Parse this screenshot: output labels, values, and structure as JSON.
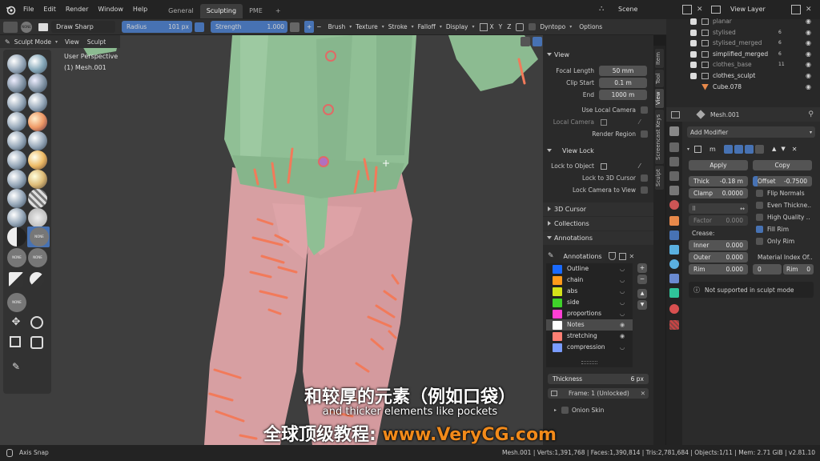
{
  "menu": {
    "items": [
      "File",
      "Edit",
      "Render",
      "Window",
      "Help"
    ]
  },
  "workspaces": [
    {
      "label": "General"
    },
    {
      "label": "Sculpting"
    },
    {
      "label": "PME"
    }
  ],
  "workspace_plus": "+",
  "scene": {
    "label": "Scene"
  },
  "view_layer": {
    "label": "View Layer"
  },
  "tool_header": {
    "brush_name": "Draw Sharp",
    "radius_label": "Radius",
    "radius_value": "101 px",
    "strength_label": "Strength",
    "strength_value": "1.000",
    "plus": "+",
    "minus": "−",
    "brush": "Brush",
    "texture": "Texture",
    "stroke": "Stroke",
    "falloff": "Falloff",
    "display": "Display",
    "x": "X",
    "y": "Y",
    "z": "Z",
    "dyntopo": "Dyntopo",
    "options": "Options"
  },
  "mode_bar": {
    "mode": "Sculpt Mode",
    "view": "View",
    "sculpt": "Sculpt"
  },
  "viewport": {
    "perspective": "User Perspective",
    "object": "(1) Mesh.001",
    "colors": {
      "shirt": "#8fbf94",
      "pants": "#d9a0a2",
      "strokes": "#f27a5a"
    }
  },
  "toolbar": {
    "none_label": "NONE"
  },
  "npanel": {
    "view_title": "View",
    "focal_length_label": "Focal Length",
    "focal_length": "50 mm",
    "clip_start_label": "Clip Start",
    "clip_start": "0.1 m",
    "end_label": "End",
    "end": "1000 m",
    "use_local_camera": "Use Local Camera",
    "local_camera": "Local Camera",
    "render_region": "Render Region",
    "view_lock_title": "View Lock",
    "lock_to_object": "Lock to Object",
    "lock_to_3d_cursor": "Lock to 3D Cursor",
    "lock_camera_to_view": "Lock Camera to View",
    "cursor_3d": "3D Cursor",
    "collections": "Collections",
    "annotations_title": "Annotations",
    "annotations_name": "Annotations",
    "layers": [
      {
        "name": "Outline",
        "color": "#1a6aff"
      },
      {
        "name": "chain",
        "color": "#ff9a1a"
      },
      {
        "name": "abs",
        "color": "#d4e21a"
      },
      {
        "name": "side",
        "color": "#3fd12a"
      },
      {
        "name": "proportions",
        "color": "#ff3fd4"
      },
      {
        "name": "Notes",
        "color": "#ffffff"
      },
      {
        "name": "stretching",
        "color": "#ff8074"
      },
      {
        "name": "compression",
        "color": "#7a9cff"
      }
    ],
    "thickness_label": "Thickness",
    "thickness_value": "6 px",
    "frame_label": "Frame: 1 (Unlocked)",
    "onion_skin": "Onion Skin"
  },
  "vertical_tabs": [
    "Item",
    "Tool",
    "View",
    "Screencast Keys",
    "Sculpt"
  ],
  "outliner": {
    "rows": [
      {
        "name": "planar"
      },
      {
        "name": "stylised",
        "badge": "6"
      },
      {
        "name": "stylised_merged",
        "badge": "6"
      },
      {
        "name": "simplified_merged",
        "badge": "6"
      },
      {
        "name": "clothes_base",
        "badge": "11"
      },
      {
        "name": "clothes_sculpt"
      },
      {
        "name": "Cube.078"
      }
    ]
  },
  "properties": {
    "object_name": "Mesh.001",
    "add_modifier": "Add Modifier",
    "modifier_name": "m",
    "apply": "Apply",
    "copy": "Copy",
    "thick_label": "Thick",
    "thick_value": "-0.18 m",
    "offset_label": "Offset",
    "offset_value": "-0.7500",
    "clamp_label": "Clamp",
    "clamp_value": "0.0000",
    "flip_normals": "Flip Normals",
    "even_thickness": "Even Thickne..",
    "high_quality": "High Quality ..",
    "fill_rim": "Fill Rim",
    "only_rim": "Only Rim",
    "factor_label": "Factor",
    "factor_value": "0.000",
    "crease_label": "Crease:",
    "inner_label": "Inner",
    "inner_value": "0.000",
    "outer_label": "Outer",
    "outer_value": "0.000",
    "rim_label": "Rim",
    "rim_value": "0.000",
    "material_index_label": "Material Index Of..",
    "mat_index_value": "0",
    "rim2_label": "Rim",
    "rim2_value": "0",
    "warning": "Not supported in sculpt mode"
  },
  "subtitles": {
    "chinese": "和较厚的元素（例如口袋）",
    "english": "and thicker elements like pockets",
    "watermark_prefix": "全球顶级教程: ",
    "watermark_url": "www.VeryCG.com"
  },
  "status": {
    "left": "Axis Snap",
    "right": "Mesh.001 | Verts:1,391,768 | Faces:1,390,814 | Tris:2,781,684 | Objects:1/11 | Mem: 2.71 GiB | v2.81.10"
  }
}
